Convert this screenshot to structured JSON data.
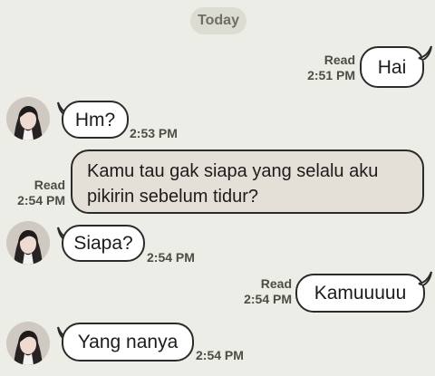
{
  "chat": {
    "date_label": "Today",
    "messages": [
      {
        "text": "Hai",
        "direction": "outgoing",
        "status": "Read",
        "time": "2:51 PM"
      },
      {
        "text": "Hm?",
        "direction": "incoming",
        "time": "2:53 PM",
        "avatar": "avatar-icon"
      },
      {
        "text": "Kamu tau gak siapa yang selalu aku pikirin sebelum tidur?",
        "direction": "outgoing",
        "status": "Read",
        "time": "2:54 PM"
      },
      {
        "text": "Siapa?",
        "direction": "incoming",
        "time": "2:54 PM",
        "avatar": "avatar-icon"
      },
      {
        "text": "Kamuuuuu",
        "direction": "outgoing",
        "status": "Read",
        "time": "2:54 PM"
      },
      {
        "text": "Yang nanya",
        "direction": "incoming",
        "time": "2:54 PM",
        "avatar": "avatar-icon"
      }
    ]
  },
  "colors": {
    "background": "#ecede6",
    "bubble_light": "#ffffff",
    "bubble_dark": "#e4e0d8",
    "border": "#2b2b2b",
    "meta_text": "#4d4d46",
    "date_pill": "#dcdcd2"
  }
}
